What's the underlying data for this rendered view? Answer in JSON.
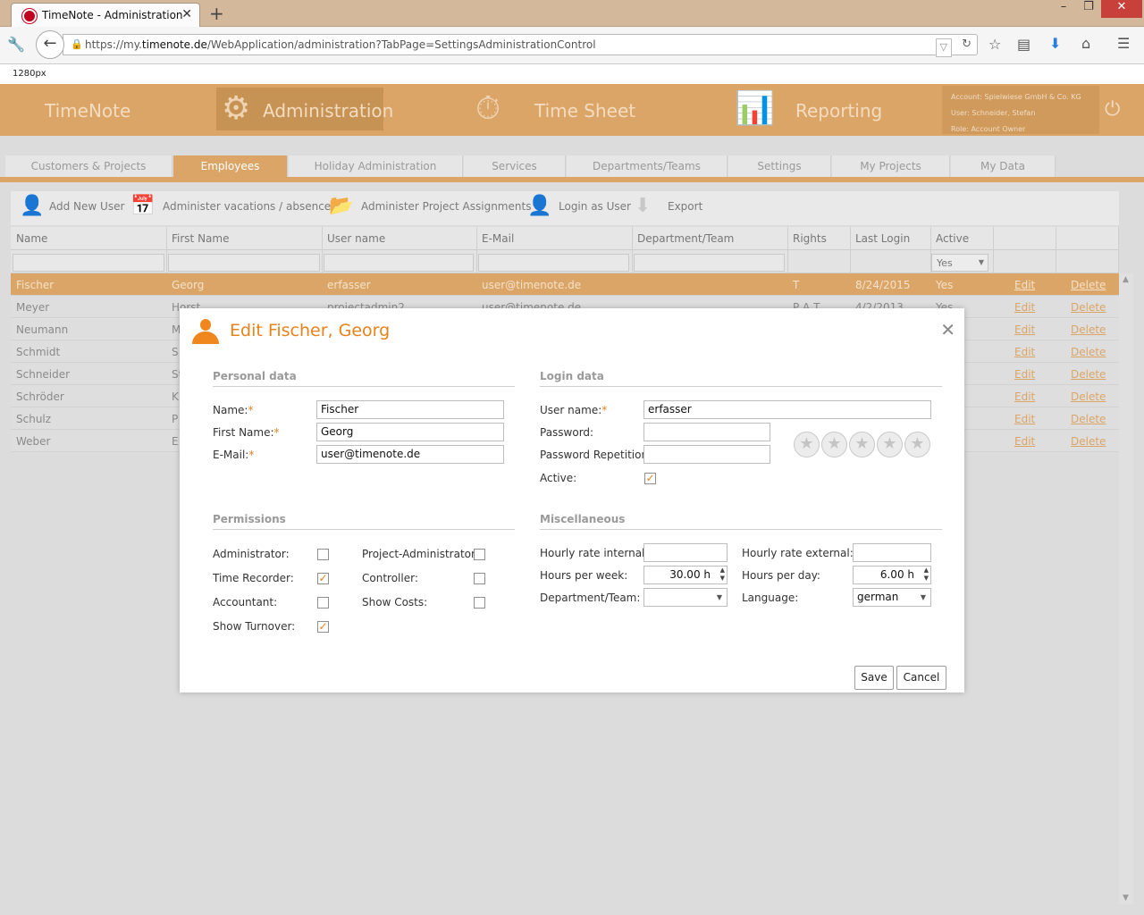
{
  "browser": {
    "tab_title": "TimeNote - Administration",
    "tab_close": "✕",
    "new_tab": "+",
    "url_prefix": "https://my.",
    "url_domain": "timenote.de",
    "url_path": "/WebApplication/administration?TabPage=SettingsAdministrationControl",
    "viewport_note": "1280px"
  },
  "header": {
    "logo": "TimeNote",
    "modules": [
      {
        "label": "Administration",
        "icon": "gear-icon",
        "active": true
      },
      {
        "label": "Time Sheet",
        "icon": "stopwatch-icon",
        "active": false
      },
      {
        "label": "Reporting",
        "icon": "bar-chart-icon",
        "active": false
      }
    ],
    "account": {
      "account_line": "Account:  Spielwiese GmbH & Co. KG",
      "user_line": "User:  Schneider, Stefan",
      "role_line": "Role:  Account Owner"
    }
  },
  "tabs": [
    {
      "label": "Customers & Projects"
    },
    {
      "label": "Employees"
    },
    {
      "label": "Holiday Administration"
    },
    {
      "label": "Services"
    },
    {
      "label": "Departments/Teams"
    },
    {
      "label": "Settings"
    },
    {
      "label": "My Projects"
    },
    {
      "label": "My Data"
    }
  ],
  "toolbar": [
    {
      "label": "Add New User",
      "icon": "add-user-icon"
    },
    {
      "label": "Administer vacations / absences",
      "icon": "calendar-icon"
    },
    {
      "label": "Administer Project Assignments",
      "icon": "folder-icon"
    },
    {
      "label": "Login as User",
      "icon": "user-login-icon"
    },
    {
      "label": "Export",
      "icon": "export-icon"
    }
  ],
  "grid": {
    "columns": [
      "Name",
      "First Name",
      "User name",
      "E-Mail",
      "Department/Team",
      "Rights",
      "Last Login",
      "Active"
    ],
    "active_filter": "Yes",
    "edit_label": "Edit",
    "delete_label": "Delete",
    "rows": [
      {
        "name": "Fischer",
        "first": "Georg",
        "user": "erfasser",
        "email": "user@timenote.de",
        "rights": "T",
        "last": "8/24/2015",
        "active": "Yes",
        "selected": true
      },
      {
        "name": "Meyer",
        "first": "Horst",
        "user": "projectadmin2",
        "email": "user@timenote.de",
        "rights": "P A T",
        "last": "4/2/2013",
        "active": "Yes",
        "selected": false
      },
      {
        "name": "Neumann",
        "first": "M",
        "user": "",
        "email": "",
        "rights": "",
        "last": "",
        "active": "",
        "selected": false
      },
      {
        "name": "Schmidt",
        "first": "S",
        "user": "",
        "email": "",
        "rights": "",
        "last": "",
        "active": "",
        "selected": false
      },
      {
        "name": "Schneider",
        "first": "St",
        "user": "",
        "email": "",
        "rights": "",
        "last": "",
        "active": "",
        "selected": false
      },
      {
        "name": "Schröder",
        "first": "K",
        "user": "",
        "email": "",
        "rights": "",
        "last": "",
        "active": "",
        "selected": false
      },
      {
        "name": "Schulz",
        "first": "P",
        "user": "",
        "email": "",
        "rights": "",
        "last": "",
        "active": "",
        "selected": false
      },
      {
        "name": "Weber",
        "first": "E",
        "user": "",
        "email": "",
        "rights": "",
        "last": "",
        "active": "",
        "selected": false
      }
    ]
  },
  "modal": {
    "title": "Edit Fischer, Georg",
    "close": "✕",
    "personal": {
      "section": "Personal data",
      "name_label": "Name:",
      "name_value": "Fischer",
      "first_label": "First Name:",
      "first_value": "Georg",
      "email_label": "E-Mail:",
      "email_value": "user@timenote.de",
      "required_mark": "*"
    },
    "login": {
      "section": "Login data",
      "user_label": "User name:",
      "user_value": "erfasser",
      "password_label": "Password:",
      "password_value": "",
      "repeat_label": "Password Repetition:",
      "repeat_value": "",
      "active_label": "Active:",
      "active_checked": true,
      "password_strength_stars": 0
    },
    "permissions": {
      "section": "Permissions",
      "administrator": "Administrator:",
      "administrator_checked": false,
      "time_recorder": "Time Recorder:",
      "time_recorder_checked": true,
      "accountant": "Accountant:",
      "accountant_checked": false,
      "show_turnover": "Show Turnover:",
      "show_turnover_checked": true,
      "project_admin": "Project-Administrator:",
      "project_admin_checked": false,
      "controller": "Controller:",
      "controller_checked": false,
      "show_costs": "Show Costs:",
      "show_costs_checked": false
    },
    "misc": {
      "section": "Miscellaneous",
      "rate_internal_label": "Hourly rate internal:",
      "rate_internal_value": "",
      "rate_external_label": "Hourly rate external:",
      "rate_external_value": "",
      "hours_week_label": "Hours per week:",
      "hours_week_value": "30.00 h",
      "hours_day_label": "Hours per day:",
      "hours_day_value": "6.00 h",
      "department_label": "Department/Team:",
      "department_value": "",
      "language_label": "Language:",
      "language_value": "german"
    },
    "save_label": "Save",
    "cancel_label": "Cancel"
  },
  "colors": {
    "brand": "#dba567",
    "accent": "#e8821a"
  }
}
